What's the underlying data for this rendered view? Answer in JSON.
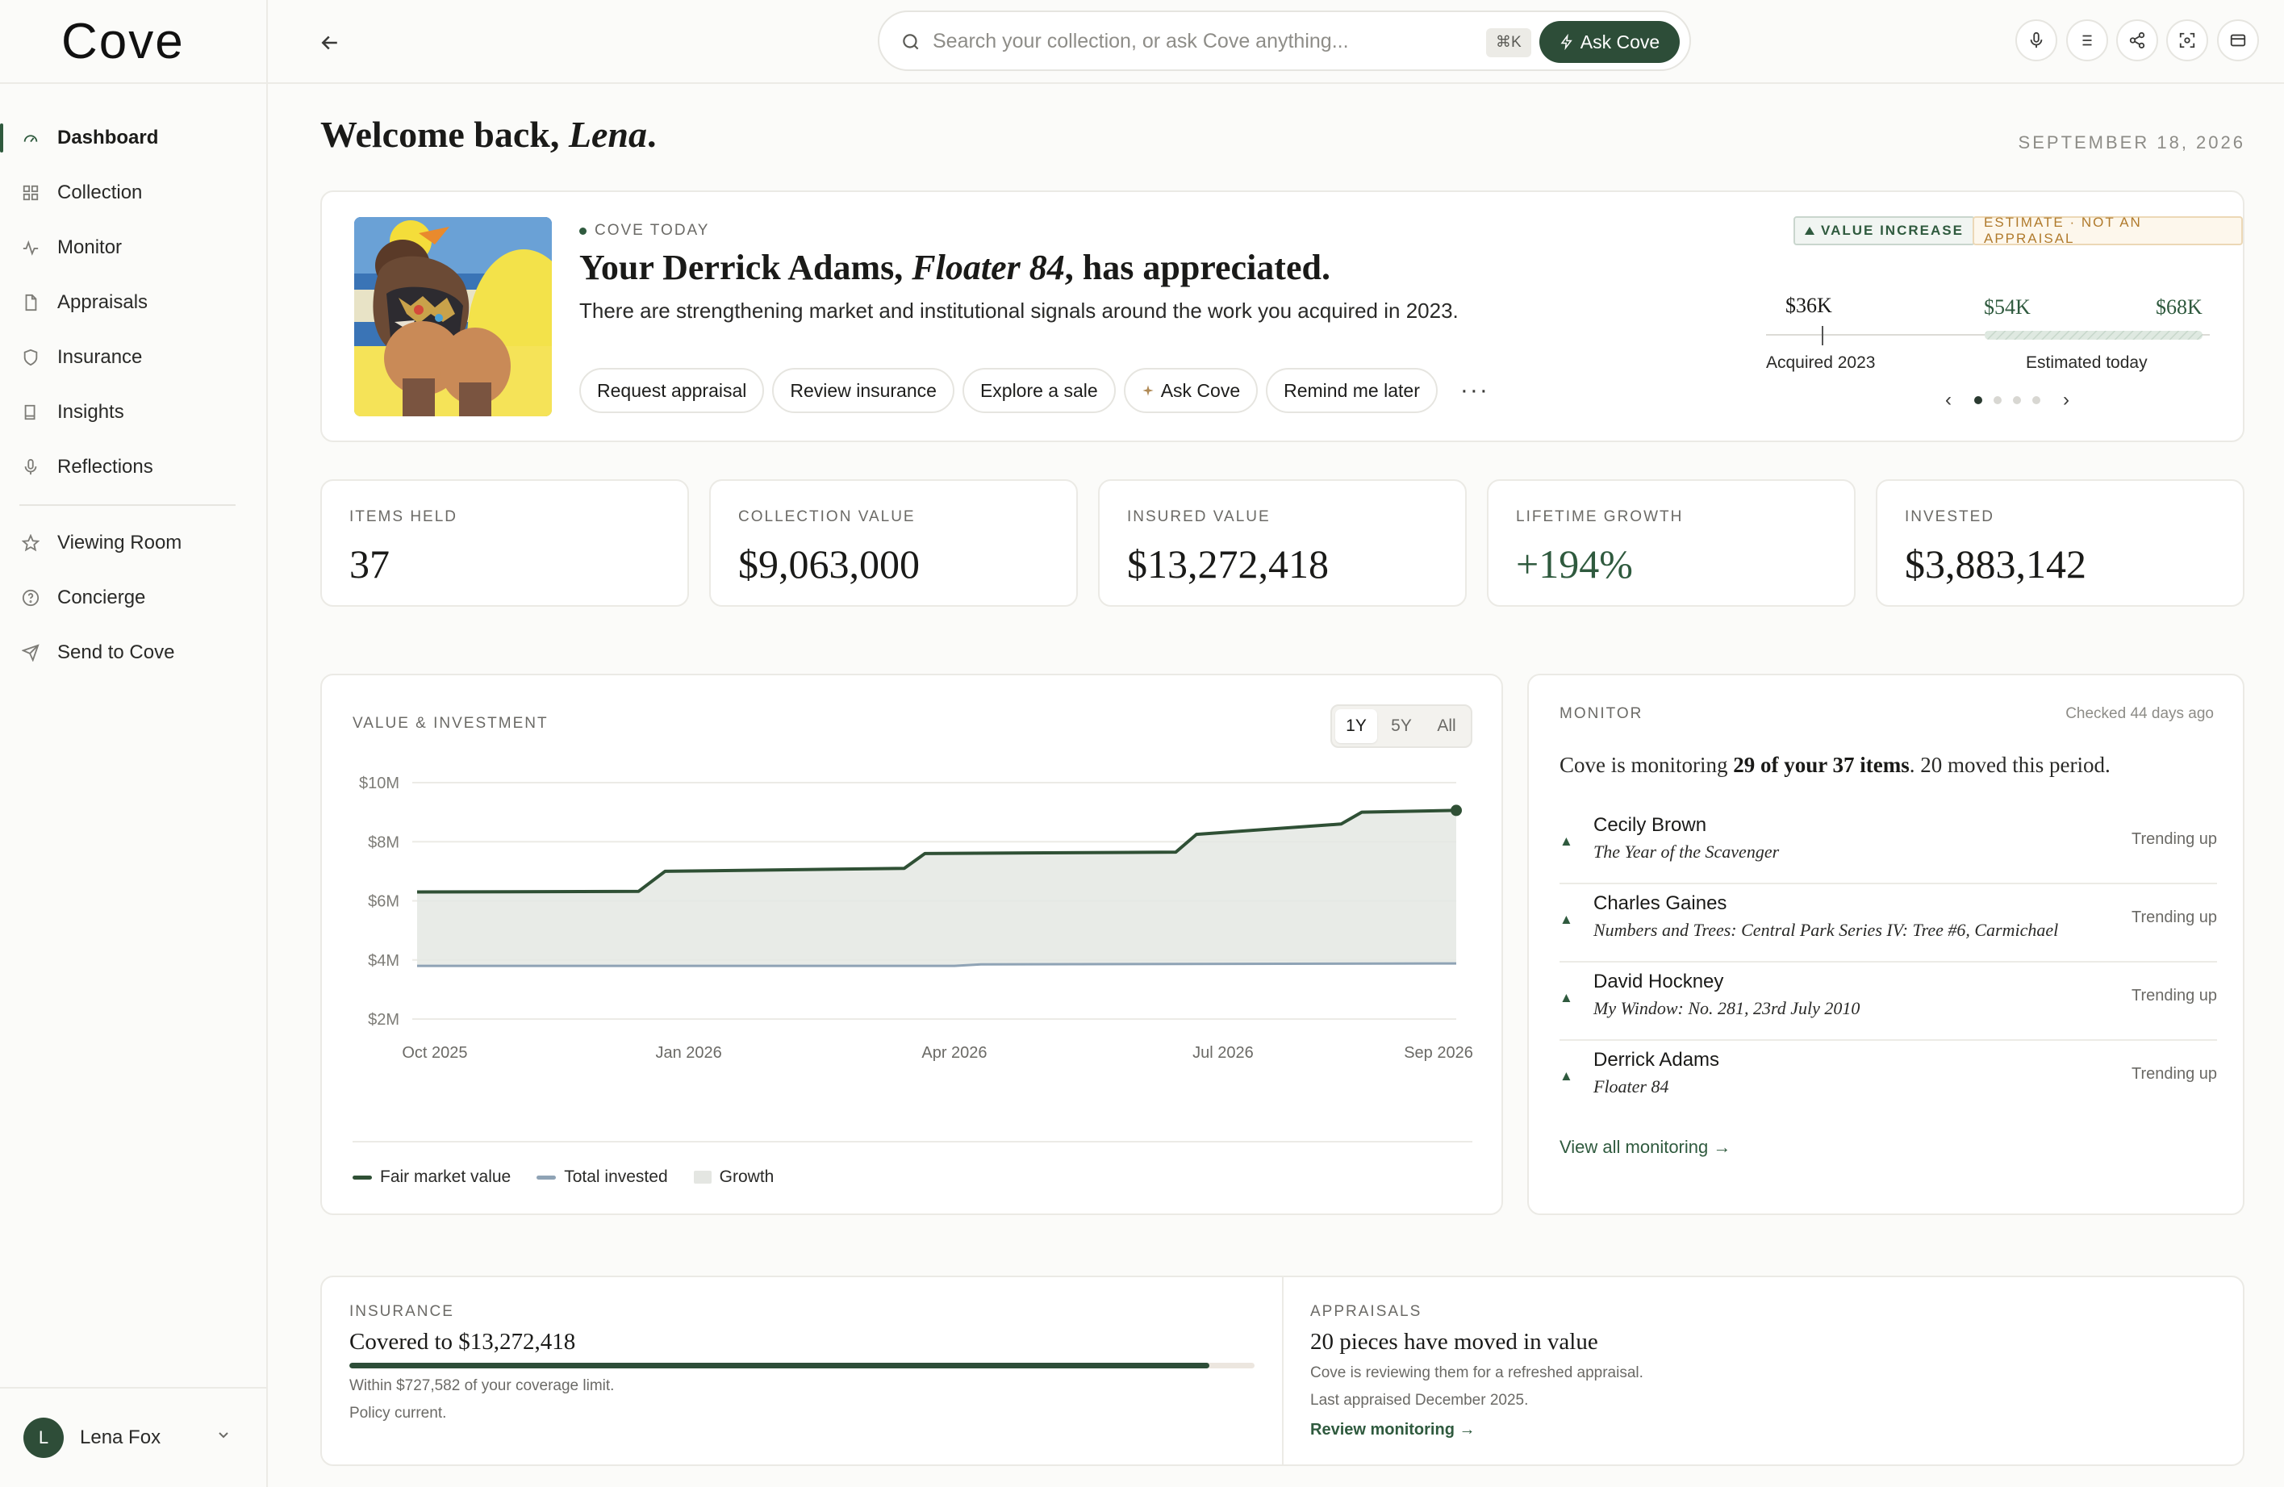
{
  "app": {
    "logo": "Cove"
  },
  "sidebar": {
    "items": [
      {
        "label": "Dashboard",
        "icon": "gauge-icon",
        "active": true
      },
      {
        "label": "Collection",
        "icon": "grid-icon"
      },
      {
        "label": "Monitor",
        "icon": "pulse-icon"
      },
      {
        "label": "Appraisals",
        "icon": "document-icon"
      },
      {
        "label": "Insurance",
        "icon": "shield-icon"
      },
      {
        "label": "Insights",
        "icon": "book-icon"
      },
      {
        "label": "Reflections",
        "icon": "microphone-icon"
      }
    ],
    "secondary": [
      {
        "label": "Viewing Room",
        "icon": "star-icon"
      },
      {
        "label": "Concierge",
        "icon": "help-circle-icon"
      },
      {
        "label": "Send to Cove",
        "icon": "send-icon"
      }
    ],
    "user": {
      "initial": "L",
      "name": "Lena Fox"
    }
  },
  "topbar": {
    "search_placeholder": "Search your collection, or ask Cove anything...",
    "shortcut": "⌘K",
    "ask_label": "Ask Cove",
    "icons": [
      "microphone-icon",
      "list-icon",
      "share-icon",
      "focus-icon",
      "panel-icon"
    ]
  },
  "welcome": {
    "prefix": "Welcome back, ",
    "name": "Lena",
    "suffix": "."
  },
  "date": "SEPTEMBER 18, 2026",
  "hero": {
    "eyebrow": "COVE TODAY",
    "title_prefix": "Your Derrick Adams, ",
    "title_work": "Floater 84",
    "title_suffix": ", has appreciated.",
    "subtitle": "There are strengthening market and institutional signals around the work you acquired in 2023.",
    "actions": [
      "Request appraisal",
      "Review insurance",
      "Explore a sale",
      "Ask Cove",
      "Remind me later"
    ],
    "more": "···",
    "badge_increase": "VALUE INCREASE",
    "badge_estimate": "ESTIMATE · NOT AN APPRAISAL",
    "scale": {
      "acquired_value": "$36K",
      "low_estimate": "$54K",
      "high_estimate": "$68K",
      "acquired_caption": "Acquired 2023",
      "estimated_caption": "Estimated today"
    },
    "carousel": {
      "count": 4,
      "active": 0
    }
  },
  "stats": [
    {
      "label": "ITEMS HELD",
      "value": "37"
    },
    {
      "label": "COLLECTION VALUE",
      "value": "$9,063,000"
    },
    {
      "label": "INSURED VALUE",
      "value": "$13,272,418"
    },
    {
      "label": "LIFETIME GROWTH",
      "value": "+194%",
      "positive": true
    },
    {
      "label": "INVESTED",
      "value": "$3,883,142"
    }
  ],
  "chart_panel": {
    "title": "VALUE & INVESTMENT",
    "ranges": [
      "1Y",
      "5Y",
      "All"
    ],
    "active_range": "1Y",
    "legend": [
      "Fair market value",
      "Total invested",
      "Growth"
    ]
  },
  "chart_data": {
    "type": "area",
    "x_ticks": [
      "Oct 2025",
      "Jan 2026",
      "Apr 2026",
      "Jul 2026",
      "Sep 2026"
    ],
    "y_ticks": [
      "$10M",
      "$8M",
      "$6M",
      "$4M",
      "$2M"
    ],
    "ylim": [
      2,
      10
    ],
    "y_unit": "$M",
    "grid": true,
    "series": [
      {
        "name": "Fair market value",
        "color": "#2f5035",
        "points": [
          [
            "2025-10-01",
            6.3
          ],
          [
            "2025-12-15",
            6.32
          ],
          [
            "2025-12-24",
            7.0
          ],
          [
            "2026-03-15",
            7.1
          ],
          [
            "2026-03-22",
            7.6
          ],
          [
            "2026-06-15",
            7.65
          ],
          [
            "2026-06-22",
            8.25
          ],
          [
            "2026-08-10",
            8.6
          ],
          [
            "2026-08-17",
            9.0
          ],
          [
            "2026-09-18",
            9.06
          ]
        ]
      },
      {
        "name": "Total invested",
        "color": "#8fa3b5",
        "points": [
          [
            "2025-10-01",
            3.8
          ],
          [
            "2026-04-01",
            3.8
          ],
          [
            "2026-04-10",
            3.85
          ],
          [
            "2026-09-18",
            3.88
          ]
        ]
      }
    ],
    "fill": {
      "name": "Growth",
      "color": "#e4e8e3"
    }
  },
  "monitor": {
    "eyebrow": "MONITOR",
    "checked": "Checked 44 days ago",
    "summary_prefix": "Cove is monitoring ",
    "summary_bold": "29 of your 37 items",
    "summary_suffix": ". 20 moved this period.",
    "items": [
      {
        "artist": "Cecily Brown",
        "work": "The Year of the Scavenger",
        "trend": "Trending up"
      },
      {
        "artist": "Charles Gaines",
        "work": "Numbers and Trees: Central Park Series IV: Tree #6, Carmichael",
        "trend": "Trending up"
      },
      {
        "artist": "David Hockney",
        "work": "My Window: No. 281, 23rd July 2010",
        "trend": "Trending up"
      },
      {
        "artist": "Derrick Adams",
        "work": "Floater 84",
        "trend": "Trending up"
      }
    ],
    "view_all": "View all monitoring →"
  },
  "insurance": {
    "eyebrow": "INSURANCE",
    "title": "Covered to $13,272,418",
    "coverage_fraction": 0.95,
    "note1": "Within $727,582 of your coverage limit.",
    "note2": "Policy current."
  },
  "appraisals": {
    "eyebrow": "APPRAISALS",
    "title": "20 pieces have moved in value",
    "note1": "Cove is reviewing them for a refreshed appraisal.",
    "note2": "Last appraised December 2025.",
    "link": "Review monitoring →"
  }
}
